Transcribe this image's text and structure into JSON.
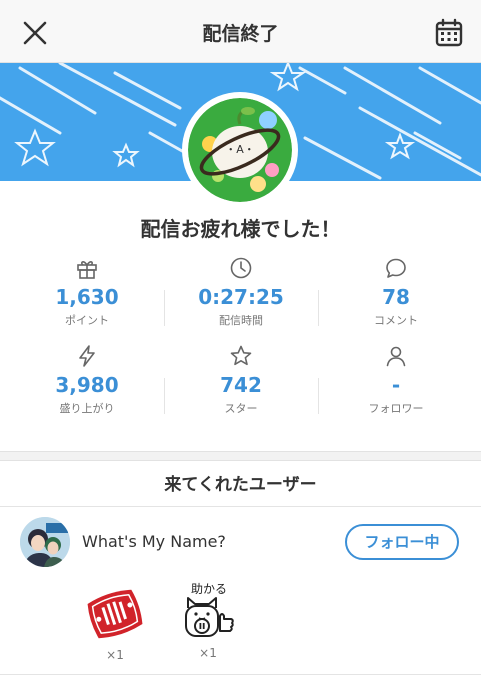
{
  "header": {
    "title": "配信終了",
    "close_icon": "close-icon",
    "calendar_icon": "calendar-icon"
  },
  "thanks_message": "配信お疲れ様でした！",
  "stats": [
    {
      "icon": "gift-icon",
      "value": "1,630",
      "label": "ポイント"
    },
    {
      "icon": "clock-icon",
      "value": "0:27:25",
      "label": "配信時間"
    },
    {
      "icon": "comment-icon",
      "value": "78",
      "label": "コメント"
    },
    {
      "icon": "lightning-icon",
      "value": "3,980",
      "label": "盛り上がり"
    },
    {
      "icon": "star-icon",
      "value": "742",
      "label": "スター"
    },
    {
      "icon": "person-icon",
      "value": "-",
      "label": "フォロワー"
    }
  ],
  "visitors": {
    "section_title": "来てくれたユーザー",
    "user": {
      "name": "What's My Name?",
      "follow_label": "フォロー中"
    },
    "gifts": [
      {
        "icon": "red-stamp-gift-icon",
        "count": "×1"
      },
      {
        "icon": "cat-thumbs-up-gift-icon",
        "count": "×1",
        "caption": "助かる"
      }
    ]
  },
  "colors": {
    "accent": "#3b8fd6",
    "banner": "#44a4ec"
  }
}
